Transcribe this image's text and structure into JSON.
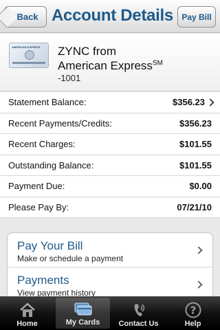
{
  "header": {
    "back_label": "Back",
    "title": "Account Details",
    "pay_bill_label": "Pay Bill"
  },
  "card": {
    "name_line1": "ZYNC from",
    "name_line2": "American Express",
    "name_line2_sup": "SM",
    "number": "-1001",
    "card_brand_text": "AMERICAN EXPRESS"
  },
  "balances": [
    {
      "label": "Statement Balance:",
      "value": "$356.23"
    },
    {
      "label": "Recent Payments/Credits:",
      "value": "$356.23"
    },
    {
      "label": "Recent Charges:",
      "value": "$101.55"
    },
    {
      "label": "Outstanding Balance:",
      "value": "$101.55"
    },
    {
      "label": "Payment Due:",
      "value": "$0.00"
    },
    {
      "label": "Please Pay By:",
      "value": "07/21/10"
    }
  ],
  "actions": [
    {
      "title": "Pay Your Bill",
      "subtitle": "Make or schedule a payment"
    },
    {
      "title": "Payments",
      "subtitle": "View payment history"
    }
  ],
  "tabbar": [
    {
      "label": "Home",
      "icon": "home-icon"
    },
    {
      "label": "My Cards",
      "icon": "cards-icon"
    },
    {
      "label": "Contact Us",
      "icon": "phone-icon"
    },
    {
      "label": "Help",
      "icon": "help-icon"
    }
  ],
  "colors": {
    "accent": "#1f5a8b",
    "tabbar": "#111111"
  }
}
